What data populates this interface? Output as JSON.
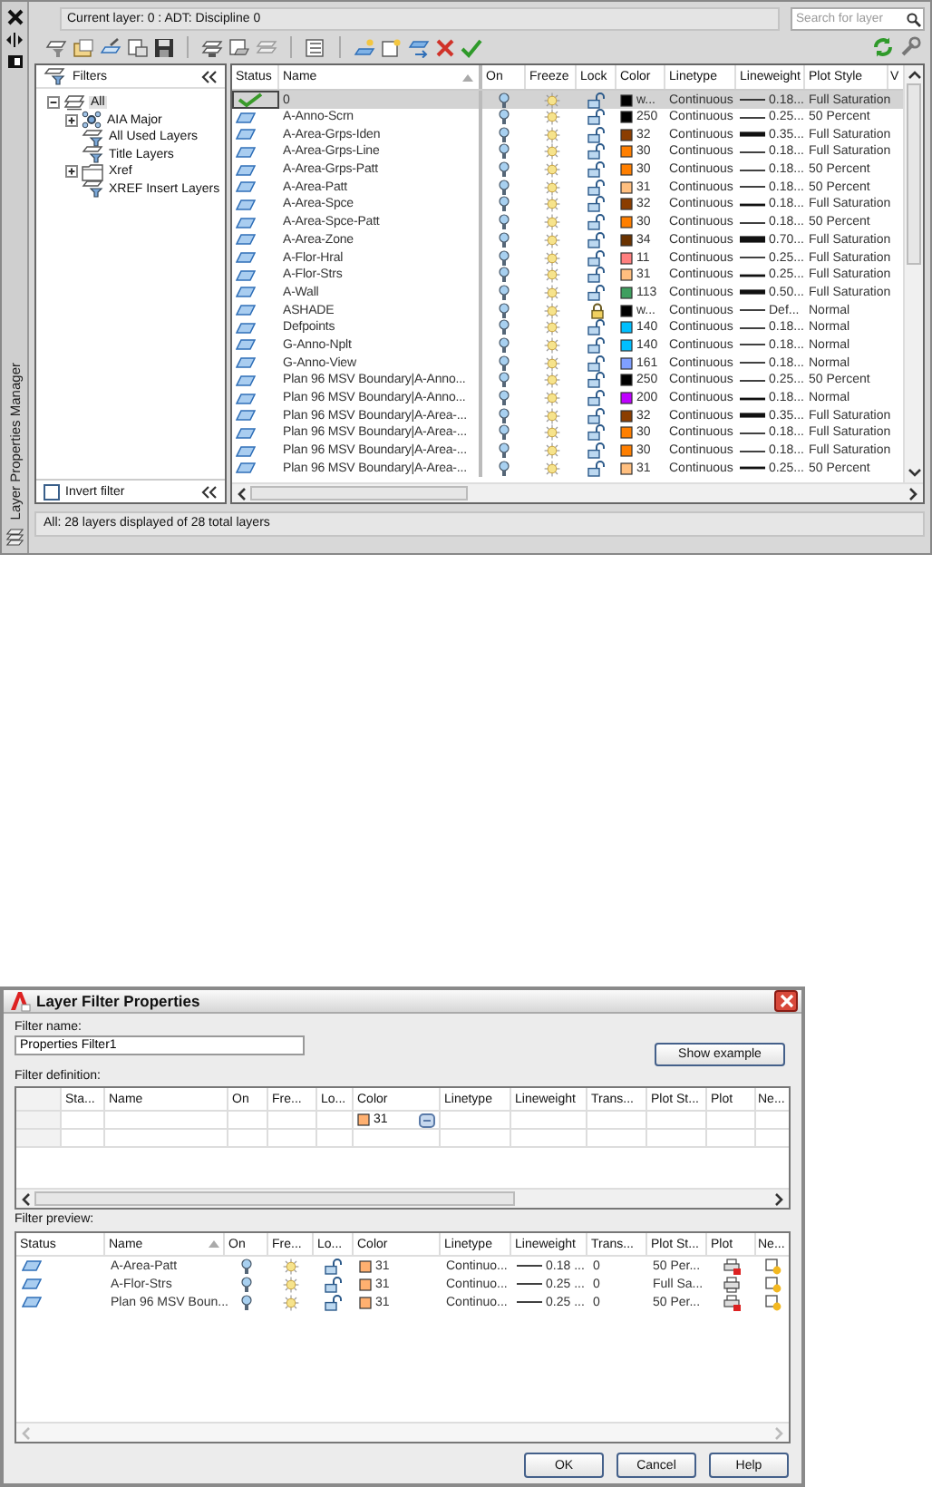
{
  "window": {
    "side_title": "Layer Properties Manager",
    "current_layer": "Current layer: 0 : ADT: Discipline 0",
    "search": {
      "placeholder": "Search for layer"
    }
  },
  "filters": {
    "title": "Filters",
    "tree": [
      {
        "label": "All",
        "kind": "all",
        "expanded": true,
        "selected": true,
        "children": [
          {
            "label": "AIA Major",
            "kind": "group",
            "expandable": true,
            "selected": false
          },
          {
            "label": "All Used Layers",
            "kind": "property",
            "expandable": false,
            "selected": false
          },
          {
            "label": "Title Layers",
            "kind": "property",
            "expandable": false,
            "selected": false
          },
          {
            "label": "Xref",
            "kind": "xref",
            "expandable": true,
            "selected": false
          },
          {
            "label": "XREF Insert Layers",
            "kind": "property",
            "expandable": false,
            "selected": false
          }
        ]
      }
    ],
    "invert_filter": {
      "label": "Invert filter",
      "checked": false
    }
  },
  "layers": {
    "columns": [
      "Status",
      "Name",
      "On",
      "Freeze",
      "Lock",
      "Color",
      "Linetype",
      "Lineweight",
      "Plot Style",
      "V"
    ],
    "rows": [
      {
        "kind": "current",
        "name": "0",
        "on": true,
        "frozen": false,
        "locked": false,
        "color": "#000000",
        "color_name": "w...",
        "linetype": "Continuous",
        "lineweight": "0.18...",
        "line": {
          "kind": "thin"
        },
        "plot_style": "Full Saturation",
        "selected": true
      },
      {
        "kind": "normal",
        "name": "A-Anno-Scrn",
        "on": true,
        "frozen": false,
        "locked": false,
        "color": "#000000",
        "color_name": "250",
        "linetype": "Continuous",
        "lineweight": "0.25...",
        "line": {
          "kind": "thin"
        },
        "plot_style": "50 Percent",
        "selected": false
      },
      {
        "kind": "normal",
        "name": "A-Area-Grps-Iden",
        "on": true,
        "frozen": false,
        "locked": false,
        "color": "#8b3d00",
        "color_name": "32",
        "linetype": "Continuous",
        "lineweight": "0.35...",
        "line": {
          "kind": "thick"
        },
        "plot_style": "Full Saturation",
        "selected": false
      },
      {
        "kind": "normal",
        "name": "A-Area-Grps-Line",
        "on": true,
        "frozen": false,
        "locked": false,
        "color": "#ff7f00",
        "color_name": "30",
        "linetype": "Continuous",
        "lineweight": "0.18...",
        "line": {
          "kind": "thin"
        },
        "plot_style": "Full Saturation",
        "selected": false
      },
      {
        "kind": "normal",
        "name": "A-Area-Grps-Patt",
        "on": true,
        "frozen": false,
        "locked": false,
        "color": "#ff7f00",
        "color_name": "30",
        "linetype": "Continuous",
        "lineweight": "0.18...",
        "line": {
          "kind": "thin"
        },
        "plot_style": "50 Percent",
        "selected": false
      },
      {
        "kind": "normal",
        "name": "A-Area-Patt",
        "on": true,
        "frozen": false,
        "locked": false,
        "color": "#ffbf7f",
        "color_name": "31",
        "linetype": "Continuous",
        "lineweight": "0.18...",
        "line": {
          "kind": "thin"
        },
        "plot_style": "50 Percent",
        "selected": false
      },
      {
        "kind": "normal",
        "name": "A-Area-Spce",
        "on": true,
        "frozen": false,
        "locked": false,
        "color": "#8b3d00",
        "color_name": "32",
        "linetype": "Continuous",
        "lineweight": "0.18...",
        "line": {
          "kind": "medium"
        },
        "plot_style": "Full Saturation",
        "selected": false
      },
      {
        "kind": "normal",
        "name": "A-Area-Spce-Patt",
        "on": true,
        "frozen": false,
        "locked": false,
        "color": "#ff7f00",
        "color_name": "30",
        "linetype": "Continuous",
        "lineweight": "0.18...",
        "line": {
          "kind": "thin"
        },
        "plot_style": "50 Percent",
        "selected": false
      },
      {
        "kind": "normal",
        "name": "A-Area-Zone",
        "on": true,
        "frozen": false,
        "locked": false,
        "color": "#6a3200",
        "color_name": "34",
        "linetype": "Continuous",
        "lineweight": "0.70...",
        "line": {
          "kind": "heavy"
        },
        "plot_style": "Full Saturation",
        "selected": false
      },
      {
        "kind": "normal",
        "name": "A-Flor-Hral",
        "on": true,
        "frozen": false,
        "locked": false,
        "color": "#ff7f7f",
        "color_name": "11",
        "linetype": "Continuous",
        "lineweight": "0.25...",
        "line": {
          "kind": "thin"
        },
        "plot_style": "Full Saturation",
        "selected": false
      },
      {
        "kind": "normal",
        "name": "A-Flor-Strs",
        "on": true,
        "frozen": false,
        "locked": false,
        "color": "#ffbf7f",
        "color_name": "31",
        "linetype": "Continuous",
        "lineweight": "0.25...",
        "line": {
          "kind": "medium"
        },
        "plot_style": "Full Saturation",
        "selected": false
      },
      {
        "kind": "normal",
        "name": "A-Wall",
        "on": true,
        "frozen": false,
        "locked": false,
        "color": "#3f9f5f",
        "color_name": "113",
        "linetype": "Continuous",
        "lineweight": "0.50...",
        "line": {
          "kind": "thick"
        },
        "plot_style": "Full Saturation",
        "selected": false
      },
      {
        "kind": "normal",
        "name": "ASHADE",
        "on": true,
        "frozen": false,
        "locked": true,
        "color": "#000000",
        "color_name": "w...",
        "linetype": "Continuous",
        "lineweight": "Def...",
        "line": {
          "kind": "thin"
        },
        "plot_style": "Normal",
        "selected": false
      },
      {
        "kind": "normal",
        "name": "Defpoints",
        "on": true,
        "frozen": false,
        "locked": false,
        "color": "#00bfff",
        "color_name": "140",
        "linetype": "Continuous",
        "lineweight": "0.18...",
        "line": {
          "kind": "thin"
        },
        "plot_style": "Normal",
        "selected": false
      },
      {
        "kind": "normal",
        "name": "G-Anno-Nplt",
        "on": true,
        "frozen": false,
        "locked": false,
        "color": "#00bfff",
        "color_name": "140",
        "linetype": "Continuous",
        "lineweight": "0.18...",
        "line": {
          "kind": "thin"
        },
        "plot_style": "Normal",
        "selected": false
      },
      {
        "kind": "normal",
        "name": "G-Anno-View",
        "on": true,
        "frozen": false,
        "locked": false,
        "color": "#7f9fff",
        "color_name": "161",
        "linetype": "Continuous",
        "lineweight": "0.18...",
        "line": {
          "kind": "thin"
        },
        "plot_style": "Normal",
        "selected": false
      },
      {
        "kind": "normal",
        "name": "Plan 96 MSV Boundary|A-Anno...",
        "on": true,
        "frozen": false,
        "locked": false,
        "color": "#000000",
        "color_name": "250",
        "linetype": "Continuous",
        "lineweight": "0.25...",
        "line": {
          "kind": "thin"
        },
        "plot_style": "50 Percent",
        "selected": false
      },
      {
        "kind": "normal",
        "name": "Plan 96 MSV Boundary|A-Anno...",
        "on": true,
        "frozen": false,
        "locked": false,
        "color": "#bf00ff",
        "color_name": "200",
        "linetype": "Continuous",
        "lineweight": "0.18...",
        "line": {
          "kind": "medium"
        },
        "plot_style": "Normal",
        "selected": false
      },
      {
        "kind": "normal",
        "name": "Plan 96 MSV Boundary|A-Area-...",
        "on": true,
        "frozen": false,
        "locked": false,
        "color": "#8b3d00",
        "color_name": "32",
        "linetype": "Continuous",
        "lineweight": "0.35...",
        "line": {
          "kind": "thick"
        },
        "plot_style": "Full Saturation",
        "selected": false
      },
      {
        "kind": "normal",
        "name": "Plan 96 MSV Boundary|A-Area-...",
        "on": true,
        "frozen": false,
        "locked": false,
        "color": "#ff7f00",
        "color_name": "30",
        "linetype": "Continuous",
        "lineweight": "0.18...",
        "line": {
          "kind": "thin"
        },
        "plot_style": "Full Saturation",
        "selected": false
      },
      {
        "kind": "normal",
        "name": "Plan 96 MSV Boundary|A-Area-...",
        "on": true,
        "frozen": false,
        "locked": false,
        "color": "#ff7f00",
        "color_name": "30",
        "linetype": "Continuous",
        "lineweight": "0.18...",
        "line": {
          "kind": "thin"
        },
        "plot_style": "Full Saturation",
        "selected": false
      },
      {
        "kind": "normal",
        "name": "Plan 96 MSV Boundary|A-Area-...",
        "on": true,
        "frozen": false,
        "locked": false,
        "color": "#ffbf7f",
        "color_name": "31",
        "linetype": "Continuous",
        "lineweight": "0.25...",
        "line": {
          "kind": "medium"
        },
        "plot_style": "50 Percent",
        "selected": false
      }
    ]
  },
  "status_bar": "All: 28 layers displayed of 28 total layers",
  "dialog": {
    "title": "Layer Filter Properties",
    "filter_name_label": "Filter name:",
    "filter_name": "Properties Filter1",
    "show_example": "Show example",
    "definition_label": "Filter definition:",
    "definition_columns": [
      "Sta...",
      "Name",
      "On",
      "Fre...",
      "Lo...",
      "Color",
      "Linetype",
      "Lineweight",
      "Trans...",
      "Plot St...",
      "Plot",
      "Ne..."
    ],
    "definition_rows": [
      {
        "color": "#ffb070",
        "color_name": "31"
      }
    ],
    "preview_label": "Filter preview:",
    "preview_columns": [
      "Status",
      "Name",
      "On",
      "Fre...",
      "Lo...",
      "Color",
      "Linetype",
      "Lineweight",
      "Trans...",
      "Plot St...",
      "Plot",
      "Ne..."
    ],
    "preview_rows": [
      {
        "kind": "normal",
        "name": "A-Area-Patt",
        "on": true,
        "frozen": false,
        "locked": false,
        "color": "#ffb070",
        "color_name": "31",
        "linetype": "Continuo...",
        "lineweight": "0.18 ...",
        "line": {
          "kind": "thin"
        },
        "transparency": "0",
        "plot_style": "50 Per...",
        "plot": false
      },
      {
        "kind": "normal",
        "name": "A-Flor-Strs",
        "on": true,
        "frozen": false,
        "locked": false,
        "color": "#ffb070",
        "color_name": "31",
        "linetype": "Continuo...",
        "lineweight": "0.25 ...",
        "line": {
          "kind": "thin"
        },
        "transparency": "0",
        "plot_style": "Full Sa...",
        "plot": true
      },
      {
        "kind": "normal",
        "name": "Plan 96 MSV Boun...",
        "on": true,
        "frozen": false,
        "locked": false,
        "color": "#ffb070",
        "color_name": "31",
        "linetype": "Continuo...",
        "lineweight": "0.25 ...",
        "line": {
          "kind": "thin"
        },
        "transparency": "0",
        "plot_style": "50 Per...",
        "plot": false
      }
    ],
    "buttons": [
      "OK",
      "Cancel",
      "Help"
    ]
  }
}
